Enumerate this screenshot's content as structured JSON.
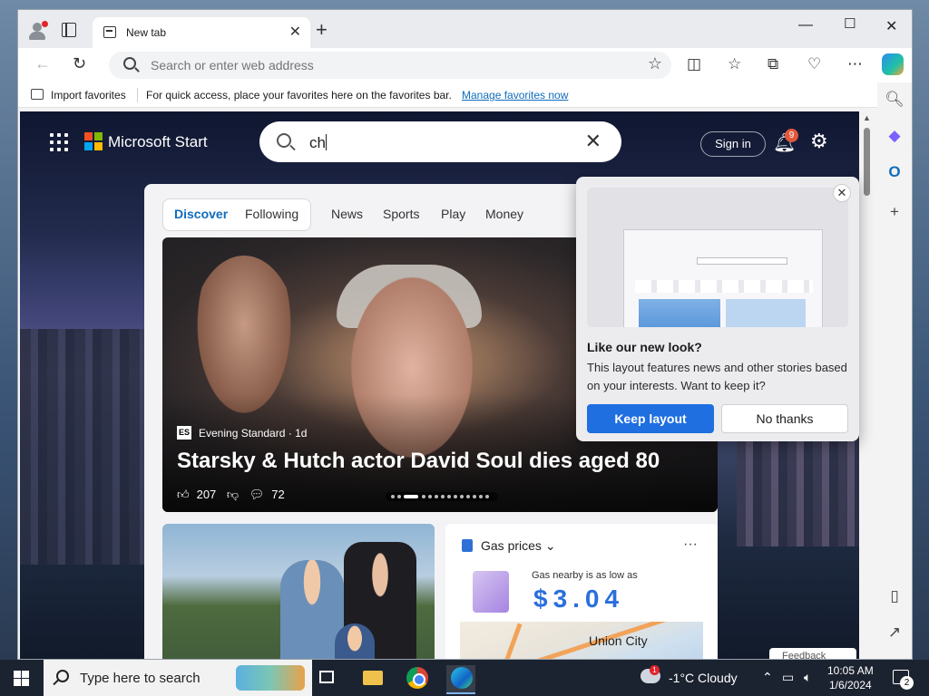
{
  "browser": {
    "tab_title": "New tab",
    "address_placeholder": "Search or enter web address",
    "favorites_bar": {
      "import_label": "Import favorites",
      "hint": "For quick access, place your favorites here on the favorites bar.",
      "manage_link": "Manage favorites now"
    }
  },
  "start_page": {
    "brand": "Microsoft Start",
    "search_query": "ch",
    "sign_in": "Sign in",
    "notification_count": "9",
    "nav_tabs": [
      "Discover",
      "Following",
      "News",
      "Sports",
      "Play",
      "Money"
    ],
    "active_tab": "Discover",
    "hero": {
      "source_logo": "ES",
      "source": "Evening Standard · 1d",
      "headline": "Starsky & Hutch actor David Soul dies aged 80",
      "likes": "207",
      "comments": "72"
    },
    "gas": {
      "title": "Gas prices",
      "label": "Gas nearby is as low as",
      "price": "$3.04",
      "map_city": "Union City",
      "more": "···"
    },
    "feedback": "Feedback"
  },
  "popup": {
    "heading": "Like our new look?",
    "body": "This layout features news and other stories based on your interests. Want to keep it?",
    "keep_button": "Keep layout",
    "no_button": "No thanks"
  },
  "taskbar": {
    "search_text": "Type here to search",
    "weather_badge": "1",
    "weather": "-1°C  Cloudy",
    "time": "10:05 AM",
    "date": "1/6/2024",
    "notification_count": "2"
  },
  "colors": {
    "accent": "#0f6cbd",
    "keep_button": "#1f6fe0",
    "gas_price": "#2a6fdc",
    "taskbar": "#1c2330"
  }
}
